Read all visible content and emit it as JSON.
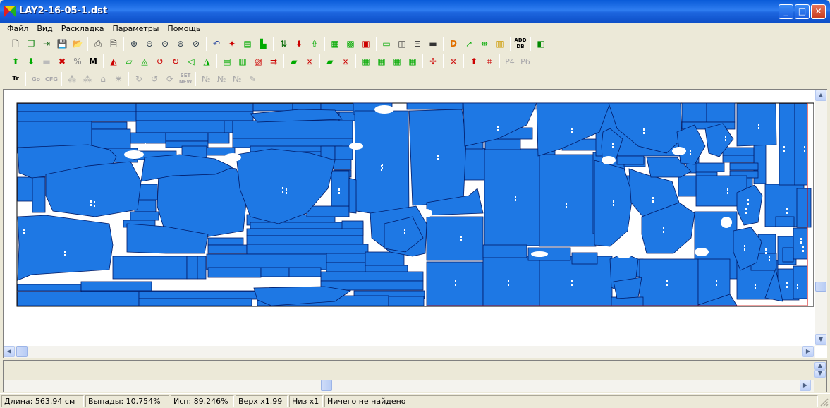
{
  "window": {
    "title": "LAY2-16-05-1.dst",
    "min_label": "_",
    "max_label": "□",
    "close_label": "✕"
  },
  "menu": [
    "Файл",
    "Вид",
    "Раскладка",
    "Параметры",
    "Помощь"
  ],
  "toolbar": {
    "row1": [
      "new-icon",
      "copy-icon",
      "import-icon",
      "save-icon",
      "open-icon",
      "|",
      "print-icon",
      "preview-icon",
      "|",
      "zoom-in-icon",
      "zoom-out-icon",
      "zoom-fit-icon",
      "zoom-window-icon",
      "zoom-prev-icon",
      "|",
      "undo-icon",
      "marker-icon",
      "stack-icon",
      "place-icon",
      "|",
      "swap-icon",
      "flip-v-icon",
      "move-up-icon",
      "|",
      "group-icon",
      "ungroup-icon",
      "merge-icon",
      "|",
      "frame-icon",
      "split-icon",
      "hline-icon",
      "ruler-icon",
      "|",
      "D",
      "arrow-diag-icon",
      "resize-icon",
      "fabric-icon",
      "|",
      "ADD DB",
      "|",
      "layers-icon"
    ],
    "row2": [
      "arrow-up-icon",
      "arrow-down-icon",
      "disabled-block-icon",
      "cross-icon",
      "percent-icon",
      "M",
      "|",
      "rotate-a-icon",
      "shear-icon",
      "rotate-b-icon",
      "rotate-ccw-icon",
      "rotate-cw-icon",
      "mirror-h-icon",
      "mirror-v-icon",
      "|",
      "align-left-icon",
      "align-center-icon",
      "align-x-icon",
      "align-right-icon",
      "|",
      "piece-icon",
      "delete-piece-icon",
      "|",
      "piece-b-icon",
      "delete-b-icon",
      "|",
      "arrange-icon",
      "arrange2-icon",
      "arrange3-icon",
      "arrange4-icon",
      "|",
      "center-icon",
      "|",
      "remove-icon",
      "|",
      "lift-icon",
      "bound-icon",
      "|",
      "P4",
      "P6"
    ],
    "row3": [
      "Tr",
      "|",
      "Go",
      "CFG",
      "|",
      "ins-1-icon",
      "ins-2-icon",
      "gap-icon",
      "spark-icon",
      "|",
      "redo-icon",
      "undo2-icon",
      "cycle-icon",
      "SET NEW",
      "|",
      "num1-icon",
      "num2-icon",
      "num3-icon",
      "edit-icon"
    ]
  },
  "colors": {
    "piece": "#1e78e4",
    "piece_border": "#001a66",
    "canvas": "#ffffff",
    "boundary": "#cc0000"
  },
  "status": {
    "length": "Длина: 563.94 см",
    "waste": "Выпады: 10.754%",
    "usage": "Исп: 89.246%",
    "top": "Верх x1.99",
    "bottom": "Низ x1",
    "message": "Ничего не найдено"
  }
}
